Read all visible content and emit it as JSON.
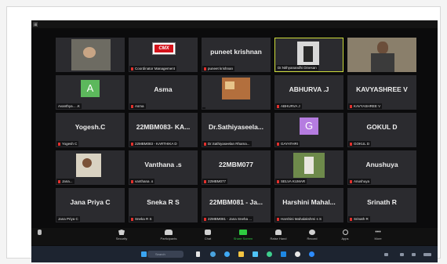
{
  "participants": [
    {
      "name": "",
      "label": ""
    },
    {
      "name": "",
      "label": "Coordinator Management"
    },
    {
      "name": "puneet krishnan",
      "label": "puneet krishnan"
    },
    {
      "name": "",
      "label": "Dr.Nithyanandhi Dinesan"
    },
    {
      "name": "",
      "label": ""
    },
    {
      "name": "",
      "avatar": "A",
      "avatar_color": "#5cb85c",
      "label": "Avanthya.....K"
    },
    {
      "name": "Asma",
      "label": "Asma"
    },
    {
      "name": "",
      "label": ""
    },
    {
      "name": "ABHURVA .J",
      "label": "ABHURVA J"
    },
    {
      "name": "KAVYASHREE V",
      "label": "KAVYASHREE V"
    },
    {
      "name": "Yogesh.C",
      "label": "Yogesh C"
    },
    {
      "name": "22MBM083- KA...",
      "label": "22MBM083 - KARTHIKA D"
    },
    {
      "name": "Dr.Sathiyaseela...",
      "label": "Dr.Sathiyaseelan Rhama..."
    },
    {
      "name": "",
      "avatar": "G",
      "avatar_color": "#b57ce0",
      "label": "GAYATHRI"
    },
    {
      "name": "GOKUL D",
      "label": "GOKUL D"
    },
    {
      "name": "",
      "label": "Jana..."
    },
    {
      "name": "Vanthana .s",
      "label": "vanthana .s"
    },
    {
      "name": "22MBM077",
      "label": "22MBM077"
    },
    {
      "name": "",
      "label": "SELVA KUMAR"
    },
    {
      "name": "Anushuya",
      "label": "Anushuya"
    },
    {
      "name": "Jana Priya C",
      "label": "Jana Priya C"
    },
    {
      "name": "Sneka R S",
      "label": "Sneka R S"
    },
    {
      "name": "22MBM081 - Ja...",
      "label": "22MBM081 - Jana Sneha ..."
    },
    {
      "name": "Harshini Mahal...",
      "label": "Harshini Mahalakshmi s S"
    },
    {
      "name": "Srinath R",
      "label": "Srinath R"
    }
  ],
  "toolbar": {
    "items": [
      {
        "label": "Security"
      },
      {
        "label": "Participants"
      },
      {
        "label": "Chat"
      },
      {
        "label": "Share Screen"
      },
      {
        "label": "Raise Hand"
      },
      {
        "label": "Record"
      },
      {
        "label": "Apps"
      },
      {
        "label": "More"
      }
    ]
  },
  "taskbar": {
    "search_placeholder": "Search"
  },
  "colors": {
    "active_speaker_border": "#cddb3a",
    "tile_bg": "#2b2b2f",
    "share_screen": "#2ecc40",
    "taskbar": "#1d2430"
  }
}
